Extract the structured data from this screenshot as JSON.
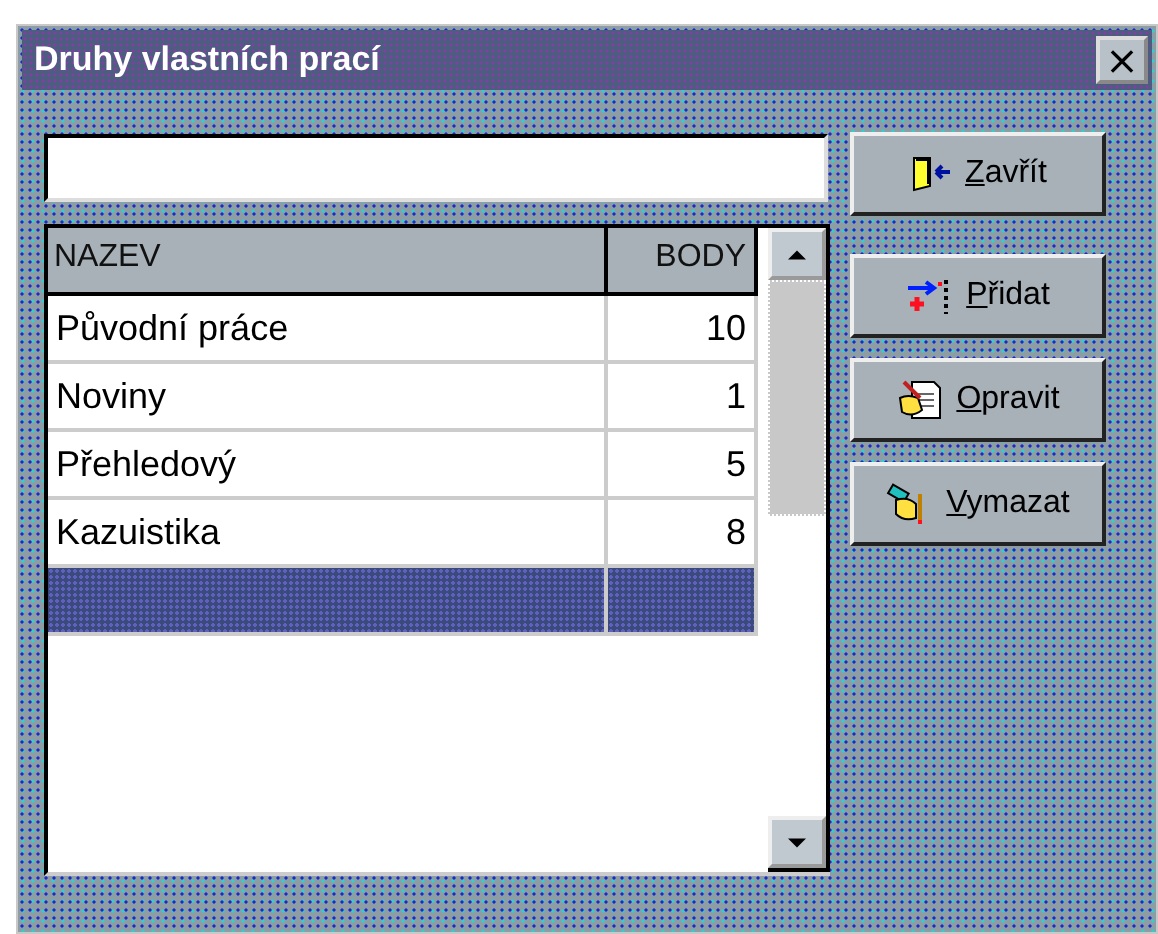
{
  "window": {
    "title": "Druhy vlastních prací",
    "close": "×"
  },
  "table": {
    "columns": [
      "NAZEV",
      "BODY"
    ],
    "rows": [
      {
        "kind": "item",
        "name": "Původní práce",
        "points": "10",
        "selected": false
      },
      {
        "kind": "item",
        "name": "Noviny",
        "points": "1",
        "selected": false
      },
      {
        "kind": "item",
        "name": "Přehledový",
        "points": "5",
        "selected": false
      },
      {
        "kind": "item",
        "name": "Kazuistika",
        "points": "8",
        "selected": false
      },
      {
        "kind": "blank",
        "selected": true
      }
    ]
  },
  "buttons": [
    {
      "kind": "close",
      "label": "Zavřít"
    },
    {
      "kind": "add",
      "label": "Přidat"
    },
    {
      "kind": "edit",
      "label": "Opravit"
    },
    {
      "kind": "delete",
      "label": "Vymazat"
    }
  ]
}
